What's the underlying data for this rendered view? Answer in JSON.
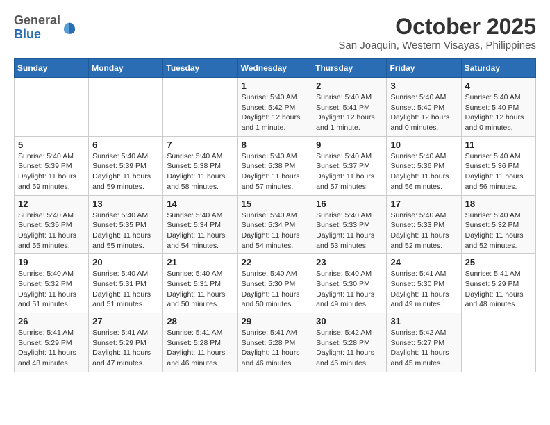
{
  "logo": {
    "text1": "General",
    "text2": "Blue"
  },
  "title": "October 2025",
  "subtitle": "San Joaquin, Western Visayas, Philippines",
  "weekdays": [
    "Sunday",
    "Monday",
    "Tuesday",
    "Wednesday",
    "Thursday",
    "Friday",
    "Saturday"
  ],
  "weeks": [
    [
      {
        "day": "",
        "info": ""
      },
      {
        "day": "",
        "info": ""
      },
      {
        "day": "",
        "info": ""
      },
      {
        "day": "1",
        "info": "Sunrise: 5:40 AM\nSunset: 5:42 PM\nDaylight: 12 hours\nand 1 minute."
      },
      {
        "day": "2",
        "info": "Sunrise: 5:40 AM\nSunset: 5:41 PM\nDaylight: 12 hours\nand 1 minute."
      },
      {
        "day": "3",
        "info": "Sunrise: 5:40 AM\nSunset: 5:40 PM\nDaylight: 12 hours\nand 0 minutes."
      },
      {
        "day": "4",
        "info": "Sunrise: 5:40 AM\nSunset: 5:40 PM\nDaylight: 12 hours\nand 0 minutes."
      }
    ],
    [
      {
        "day": "5",
        "info": "Sunrise: 5:40 AM\nSunset: 5:39 PM\nDaylight: 11 hours\nand 59 minutes."
      },
      {
        "day": "6",
        "info": "Sunrise: 5:40 AM\nSunset: 5:39 PM\nDaylight: 11 hours\nand 59 minutes."
      },
      {
        "day": "7",
        "info": "Sunrise: 5:40 AM\nSunset: 5:38 PM\nDaylight: 11 hours\nand 58 minutes."
      },
      {
        "day": "8",
        "info": "Sunrise: 5:40 AM\nSunset: 5:38 PM\nDaylight: 11 hours\nand 57 minutes."
      },
      {
        "day": "9",
        "info": "Sunrise: 5:40 AM\nSunset: 5:37 PM\nDaylight: 11 hours\nand 57 minutes."
      },
      {
        "day": "10",
        "info": "Sunrise: 5:40 AM\nSunset: 5:36 PM\nDaylight: 11 hours\nand 56 minutes."
      },
      {
        "day": "11",
        "info": "Sunrise: 5:40 AM\nSunset: 5:36 PM\nDaylight: 11 hours\nand 56 minutes."
      }
    ],
    [
      {
        "day": "12",
        "info": "Sunrise: 5:40 AM\nSunset: 5:35 PM\nDaylight: 11 hours\nand 55 minutes."
      },
      {
        "day": "13",
        "info": "Sunrise: 5:40 AM\nSunset: 5:35 PM\nDaylight: 11 hours\nand 55 minutes."
      },
      {
        "day": "14",
        "info": "Sunrise: 5:40 AM\nSunset: 5:34 PM\nDaylight: 11 hours\nand 54 minutes."
      },
      {
        "day": "15",
        "info": "Sunrise: 5:40 AM\nSunset: 5:34 PM\nDaylight: 11 hours\nand 54 minutes."
      },
      {
        "day": "16",
        "info": "Sunrise: 5:40 AM\nSunset: 5:33 PM\nDaylight: 11 hours\nand 53 minutes."
      },
      {
        "day": "17",
        "info": "Sunrise: 5:40 AM\nSunset: 5:33 PM\nDaylight: 11 hours\nand 52 minutes."
      },
      {
        "day": "18",
        "info": "Sunrise: 5:40 AM\nSunset: 5:32 PM\nDaylight: 11 hours\nand 52 minutes."
      }
    ],
    [
      {
        "day": "19",
        "info": "Sunrise: 5:40 AM\nSunset: 5:32 PM\nDaylight: 11 hours\nand 51 minutes."
      },
      {
        "day": "20",
        "info": "Sunrise: 5:40 AM\nSunset: 5:31 PM\nDaylight: 11 hours\nand 51 minutes."
      },
      {
        "day": "21",
        "info": "Sunrise: 5:40 AM\nSunset: 5:31 PM\nDaylight: 11 hours\nand 50 minutes."
      },
      {
        "day": "22",
        "info": "Sunrise: 5:40 AM\nSunset: 5:30 PM\nDaylight: 11 hours\nand 50 minutes."
      },
      {
        "day": "23",
        "info": "Sunrise: 5:40 AM\nSunset: 5:30 PM\nDaylight: 11 hours\nand 49 minutes."
      },
      {
        "day": "24",
        "info": "Sunrise: 5:41 AM\nSunset: 5:30 PM\nDaylight: 11 hours\nand 49 minutes."
      },
      {
        "day": "25",
        "info": "Sunrise: 5:41 AM\nSunset: 5:29 PM\nDaylight: 11 hours\nand 48 minutes."
      }
    ],
    [
      {
        "day": "26",
        "info": "Sunrise: 5:41 AM\nSunset: 5:29 PM\nDaylight: 11 hours\nand 48 minutes."
      },
      {
        "day": "27",
        "info": "Sunrise: 5:41 AM\nSunset: 5:29 PM\nDaylight: 11 hours\nand 47 minutes."
      },
      {
        "day": "28",
        "info": "Sunrise: 5:41 AM\nSunset: 5:28 PM\nDaylight: 11 hours\nand 46 minutes."
      },
      {
        "day": "29",
        "info": "Sunrise: 5:41 AM\nSunset: 5:28 PM\nDaylight: 11 hours\nand 46 minutes."
      },
      {
        "day": "30",
        "info": "Sunrise: 5:42 AM\nSunset: 5:28 PM\nDaylight: 11 hours\nand 45 minutes."
      },
      {
        "day": "31",
        "info": "Sunrise: 5:42 AM\nSunset: 5:27 PM\nDaylight: 11 hours\nand 45 minutes."
      },
      {
        "day": "",
        "info": ""
      }
    ]
  ]
}
